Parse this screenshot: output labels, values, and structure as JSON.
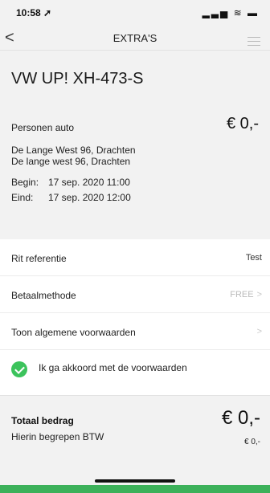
{
  "status": {
    "time": "10:58 ➚",
    "icons": "▂▃▅ ≋ ▬"
  },
  "nav": {
    "back": "<",
    "title": "EXTRA'S"
  },
  "summary": {
    "vehicle": "VW UP! XH-473-S",
    "category": "Personen auto",
    "price": "€ 0,-",
    "address1": "De Lange West 96, Drachten",
    "address2": "De lange west 96, Drachten",
    "begin_label": "Begin:",
    "begin_value": "17 sep. 2020 11:00",
    "end_label": "Eind:",
    "end_value": "17 sep. 2020 12:00"
  },
  "rows": {
    "ref_label": "Rit referentie",
    "ref_value": "Test",
    "pay_label": "Betaalmethode",
    "pay_value": "FREE",
    "terms_label": "Toon algemene voorwaarden",
    "agree_label": "Ik ga akkoord met de voorwaarden",
    "chevron": ">"
  },
  "total": {
    "label": "Totaal bedrag",
    "amount": "€ 0,-",
    "vat_label": "Hierin begrepen BTW",
    "vat_amount": "€ 0,-"
  },
  "colors": {
    "accent": "#3cc35c",
    "background": "#f2f2f2"
  }
}
